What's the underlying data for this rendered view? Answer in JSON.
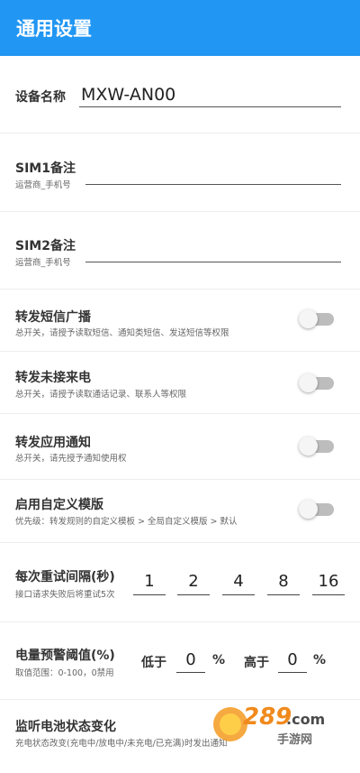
{
  "appbar": {
    "title": "通用设置"
  },
  "device": {
    "label": "设备名称",
    "value": "MXW-AN00"
  },
  "sim1": {
    "title": "SIM1备注",
    "hint": "运营商_手机号",
    "value": ""
  },
  "sim2": {
    "title": "SIM2备注",
    "hint": "运营商_手机号",
    "value": ""
  },
  "toggles": [
    {
      "title": "转发短信广播",
      "desc": "总开关，请授予读取短信、通知类短信、发送短信等权限",
      "on": false
    },
    {
      "title": "转发未接来电",
      "desc": "总开关，请授予读取通话记录、联系人等权限",
      "on": false
    },
    {
      "title": "转发应用通知",
      "desc": "总开关，请先授予通知使用权",
      "on": false
    },
    {
      "title": "启用自定义模版",
      "desc": "优先级：转发规则的自定义模板 > 全局自定义模版 > 默认",
      "on": false
    }
  ],
  "retry": {
    "title": "每次重试间隔(秒)",
    "desc": "接口请求失败后将重试5次",
    "values": [
      "1",
      "2",
      "4",
      "8",
      "16"
    ]
  },
  "battery_alarm": {
    "title": "电量预警阈值(%)",
    "desc": "取值范围：0-100，0禁用",
    "low_label": "低于",
    "low_value": "0",
    "high_label": "高于",
    "high_value": "0",
    "percent": "%"
  },
  "battery_monitor": {
    "title": "监听电池状态变化",
    "desc": "充电状态改变(充电中/放电中/未充电/已充满)时发出通知"
  },
  "watermark": {
    "text": "289.com",
    "tagline": "手游网"
  },
  "colors": {
    "appbar": "#2196f3",
    "toggle_track": "#bdbdbd",
    "toggle_knob": "#f5f5f5"
  }
}
